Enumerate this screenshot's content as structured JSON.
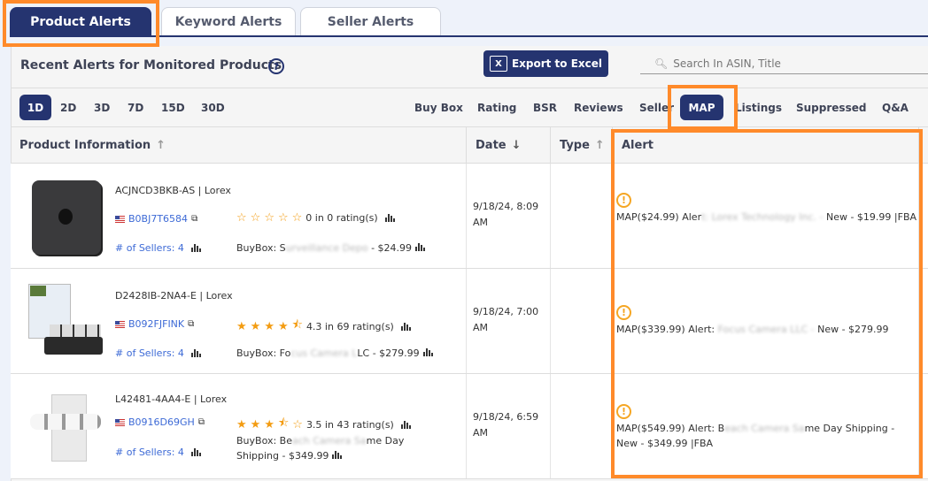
{
  "tabs": [
    {
      "label": "Product Alerts",
      "active": true
    },
    {
      "label": "Keyword Alerts"
    },
    {
      "label": "Seller Alerts"
    }
  ],
  "header": {
    "title": "Recent Alerts for Monitored Products",
    "help_icon": "question-circle-icon",
    "export_label": "Export to Excel",
    "search_placeholder": "Search In ASIN, Title"
  },
  "periods": [
    "1D",
    "2D",
    "3D",
    "7D",
    "15D",
    "30D"
  ],
  "active_period": "1D",
  "alert_types": [
    "Buy Box",
    "Rating",
    "BSR",
    "Reviews",
    "Seller",
    "MAP",
    "Listings",
    "Suppressed",
    "Q&A"
  ],
  "active_alert_type": "MAP",
  "columns": {
    "product": "Product Information",
    "date": "Date",
    "type": "Type",
    "alert": "Alert"
  },
  "colors": {
    "navy": "#253470",
    "highlight": "#ff8a2a",
    "link": "#3d6ad6",
    "star": "#f39c12",
    "warning": "#f5a623"
  },
  "rows": [
    {
      "sku": "ACJNCD3BKB-AS | Lorex",
      "asin": "B0BJ7T6584",
      "rating": 0,
      "rating_text": "0 in 0 rating(s)",
      "sellers": "# of Sellers: 4",
      "buybox_prefix": "BuyBox: S",
      "buybox_seller": "urveillance Depo",
      "buybox_price": " - $24.99",
      "date": "9/18/24, 8:09 AM",
      "alert_prefix": "MAP($24.99) Aler",
      "alert_seller": "t: Lorex Technology Inc. -",
      "alert_suffix": " New - $19.99 |FBA"
    },
    {
      "sku": "D2428IB-2NA4-E | Lorex",
      "asin": "B092FJFINK",
      "rating": 4.5,
      "rating_text": "4.3 in 69 rating(s)",
      "sellers": "# of Sellers: 4",
      "buybox_prefix": "BuyBox: Fo",
      "buybox_seller": "cus Camera L",
      "buybox_price": "LC - $279.99",
      "date": "9/18/24, 7:00 AM",
      "alert_prefix": "MAP($339.99) Alert: ",
      "alert_seller": "Focus Camera LLC -",
      "alert_suffix": " New - $279.99"
    },
    {
      "sku": "L42481-4AA4-E | Lorex",
      "asin": "B0916D69GH",
      "rating": 3.5,
      "rating_text": "3.5 in 43 rating(s)",
      "sellers": "# of Sellers: 4",
      "buybox_prefix": "BuyBox: Be",
      "buybox_seller": "ach Camera Sa",
      "buybox_price": "me Day Shipping - $349.99",
      "date": "9/18/24, 6:59 AM",
      "alert_prefix": "MAP($549.99) Alert: B",
      "alert_seller": "each Camera Sa",
      "alert_suffix": "me Day Shipping - New - $349.99 |FBA"
    }
  ]
}
